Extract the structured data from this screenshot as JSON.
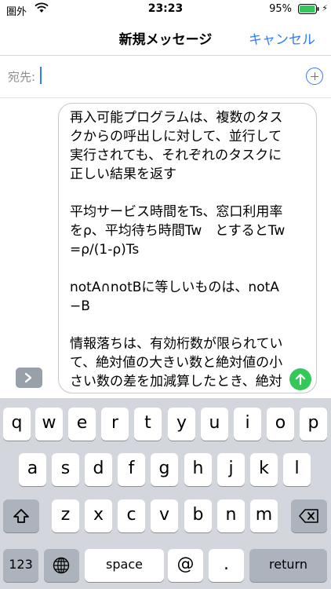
{
  "status": {
    "carrier": "圏外",
    "time": "23:23",
    "battery": "95%"
  },
  "nav": {
    "title": "新規メッセージ",
    "cancel": "キャンセル"
  },
  "to": {
    "label": "宛先:"
  },
  "message": {
    "body": "再入可能プログラムは、複数のタスクからの呼出しに対して、並行して実行されても、それぞれのタスクに正しい結果を返す\n\n平均サービス時間をTs、窓口利用率をρ、平均待ち時間Tw　とするとTw=ρ/(1-ρ)Ts\n\nnotA∩notBに等しいものは、notA−B\n\n情報落ちは、有効桁数が限られていて、絶対値の大きい数と絶対値の小さい数の差を加減算したとき、絶対値の小さい数が無視され"
  },
  "keyboard": {
    "row1": [
      "q",
      "w",
      "e",
      "r",
      "t",
      "y",
      "u",
      "i",
      "o",
      "p"
    ],
    "row2": [
      "a",
      "s",
      "d",
      "f",
      "g",
      "h",
      "j",
      "k",
      "l"
    ],
    "row3": [
      "z",
      "x",
      "c",
      "v",
      "b",
      "n",
      "m"
    ],
    "numbers_label": "123",
    "space_label": "space",
    "at_label": "@",
    "period_label": ".",
    "return_label": "return"
  },
  "colors": {
    "accent": "#2f7cf6",
    "send": "#34c759",
    "keyboard_bg": "#d3d6dc"
  }
}
